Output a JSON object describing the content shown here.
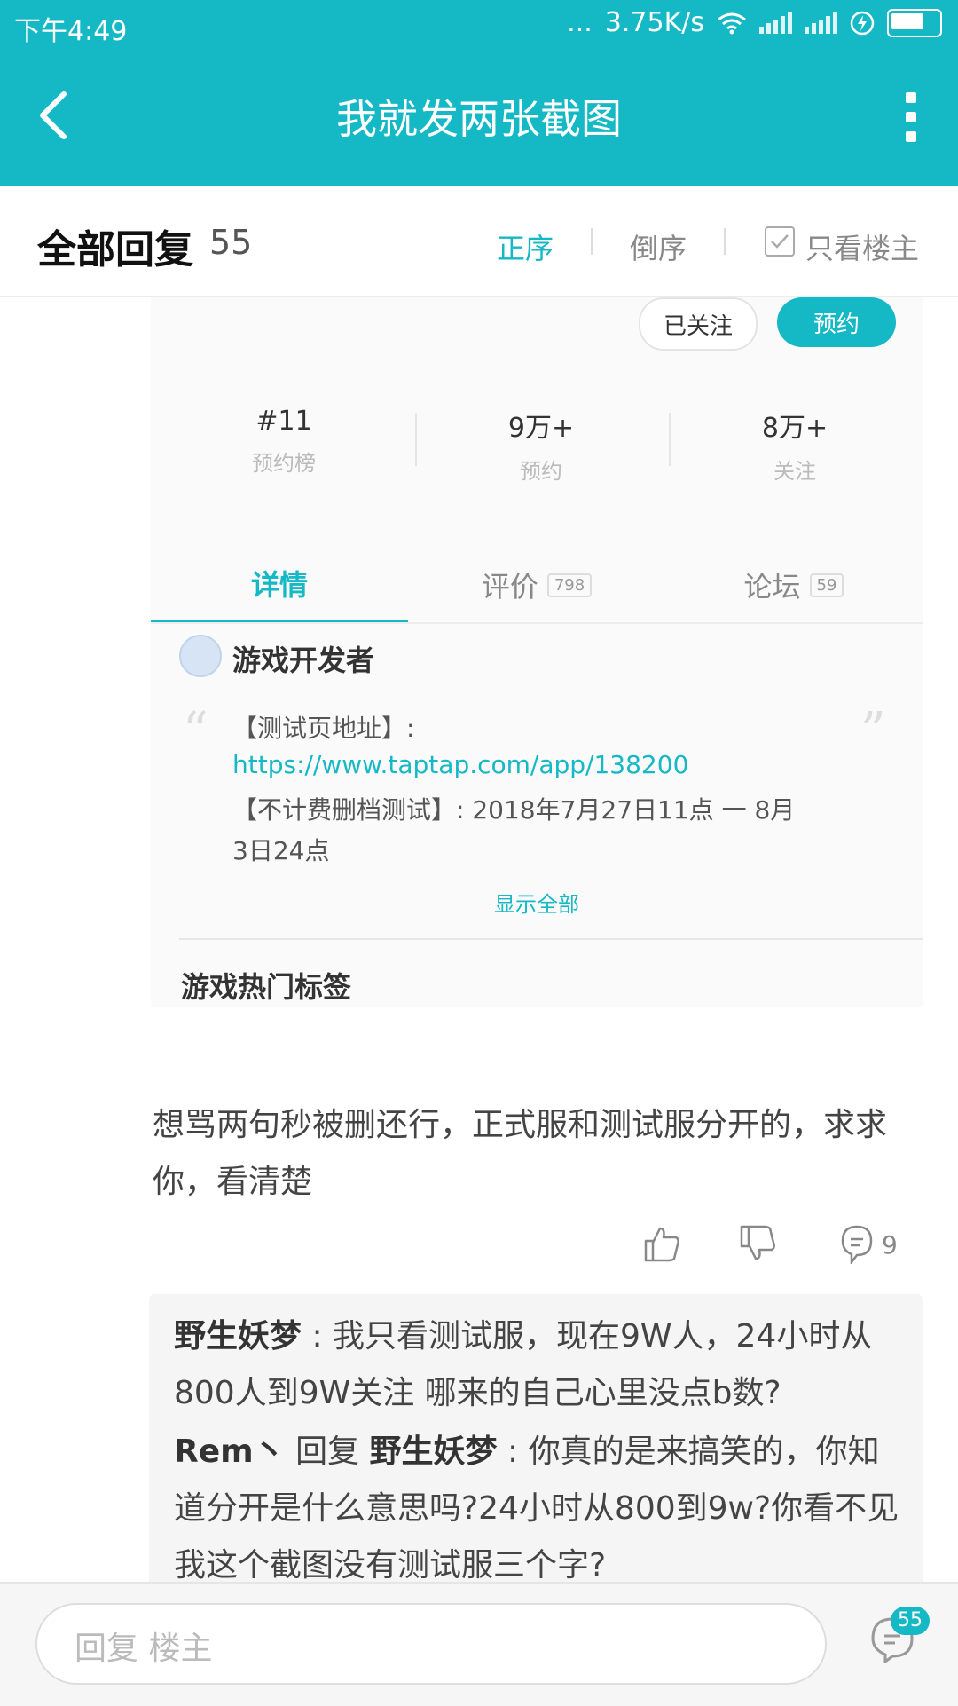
{
  "colors": {
    "accent": "#15b8c5",
    "text": "#333333",
    "muted": "#999999"
  },
  "status_bar": {
    "time": "下午4:49",
    "dots": "...",
    "speed": "3.75K/s"
  },
  "app_bar": {
    "title": "我就发两张截图"
  },
  "sort_bar": {
    "title": "全部回复",
    "count": "55",
    "asc": "正序",
    "desc": "倒序",
    "owner_only": "只看楼主"
  },
  "game_card": {
    "followed": "已关注",
    "reserve": "预约",
    "stats": [
      {
        "value": "#11",
        "label": "预约榜"
      },
      {
        "value": "9万+",
        "label": "预约"
      },
      {
        "value": "8万+",
        "label": "关注"
      }
    ],
    "tabs": [
      {
        "label": "详情",
        "badge": ""
      },
      {
        "label": "评价",
        "badge": "798"
      },
      {
        "label": "论坛",
        "badge": "59"
      }
    ],
    "developer": "游戏开发者",
    "desc_line1": "【测试页地址】:",
    "desc_link": "https://www.taptap.com/app/138200",
    "desc_line2": "【不计费删档测试】: 2018年7月27日11点 一 8月",
    "desc_line3": "3日24点",
    "show_all": "显示全部",
    "hot_tags": "游戏热门标签"
  },
  "post": {
    "text": "想骂两句秒被删还行，正式服和测试服分开的，求求你，看清楚",
    "comment_count": "9"
  },
  "replies": [
    {
      "author": "野生妖梦",
      "reply_word": "",
      "target": "",
      "text": " : 我只看测试服，现在9W人，24小时从800人到9W关注 哪来的自己心里没点b数?"
    },
    {
      "author": "Rem丶",
      "reply_word": " 回复 ",
      "target": "野生妖梦",
      "text": " : 你真的是来搞笑的，你知道分开是什么意思吗?24小时从800到9w?你看不见我这个截图没有测试服三个字?"
    }
  ],
  "bottom_bar": {
    "placeholder": "回复  楼主",
    "badge": "55"
  },
  "icons": [
    "back-icon",
    "more-icon",
    "wifi-icon",
    "signal-icon",
    "charging-icon",
    "battery-icon",
    "checkbox-icon",
    "quote-open-icon",
    "quote-close-icon",
    "like-icon",
    "dislike-icon",
    "comment-icon"
  ]
}
